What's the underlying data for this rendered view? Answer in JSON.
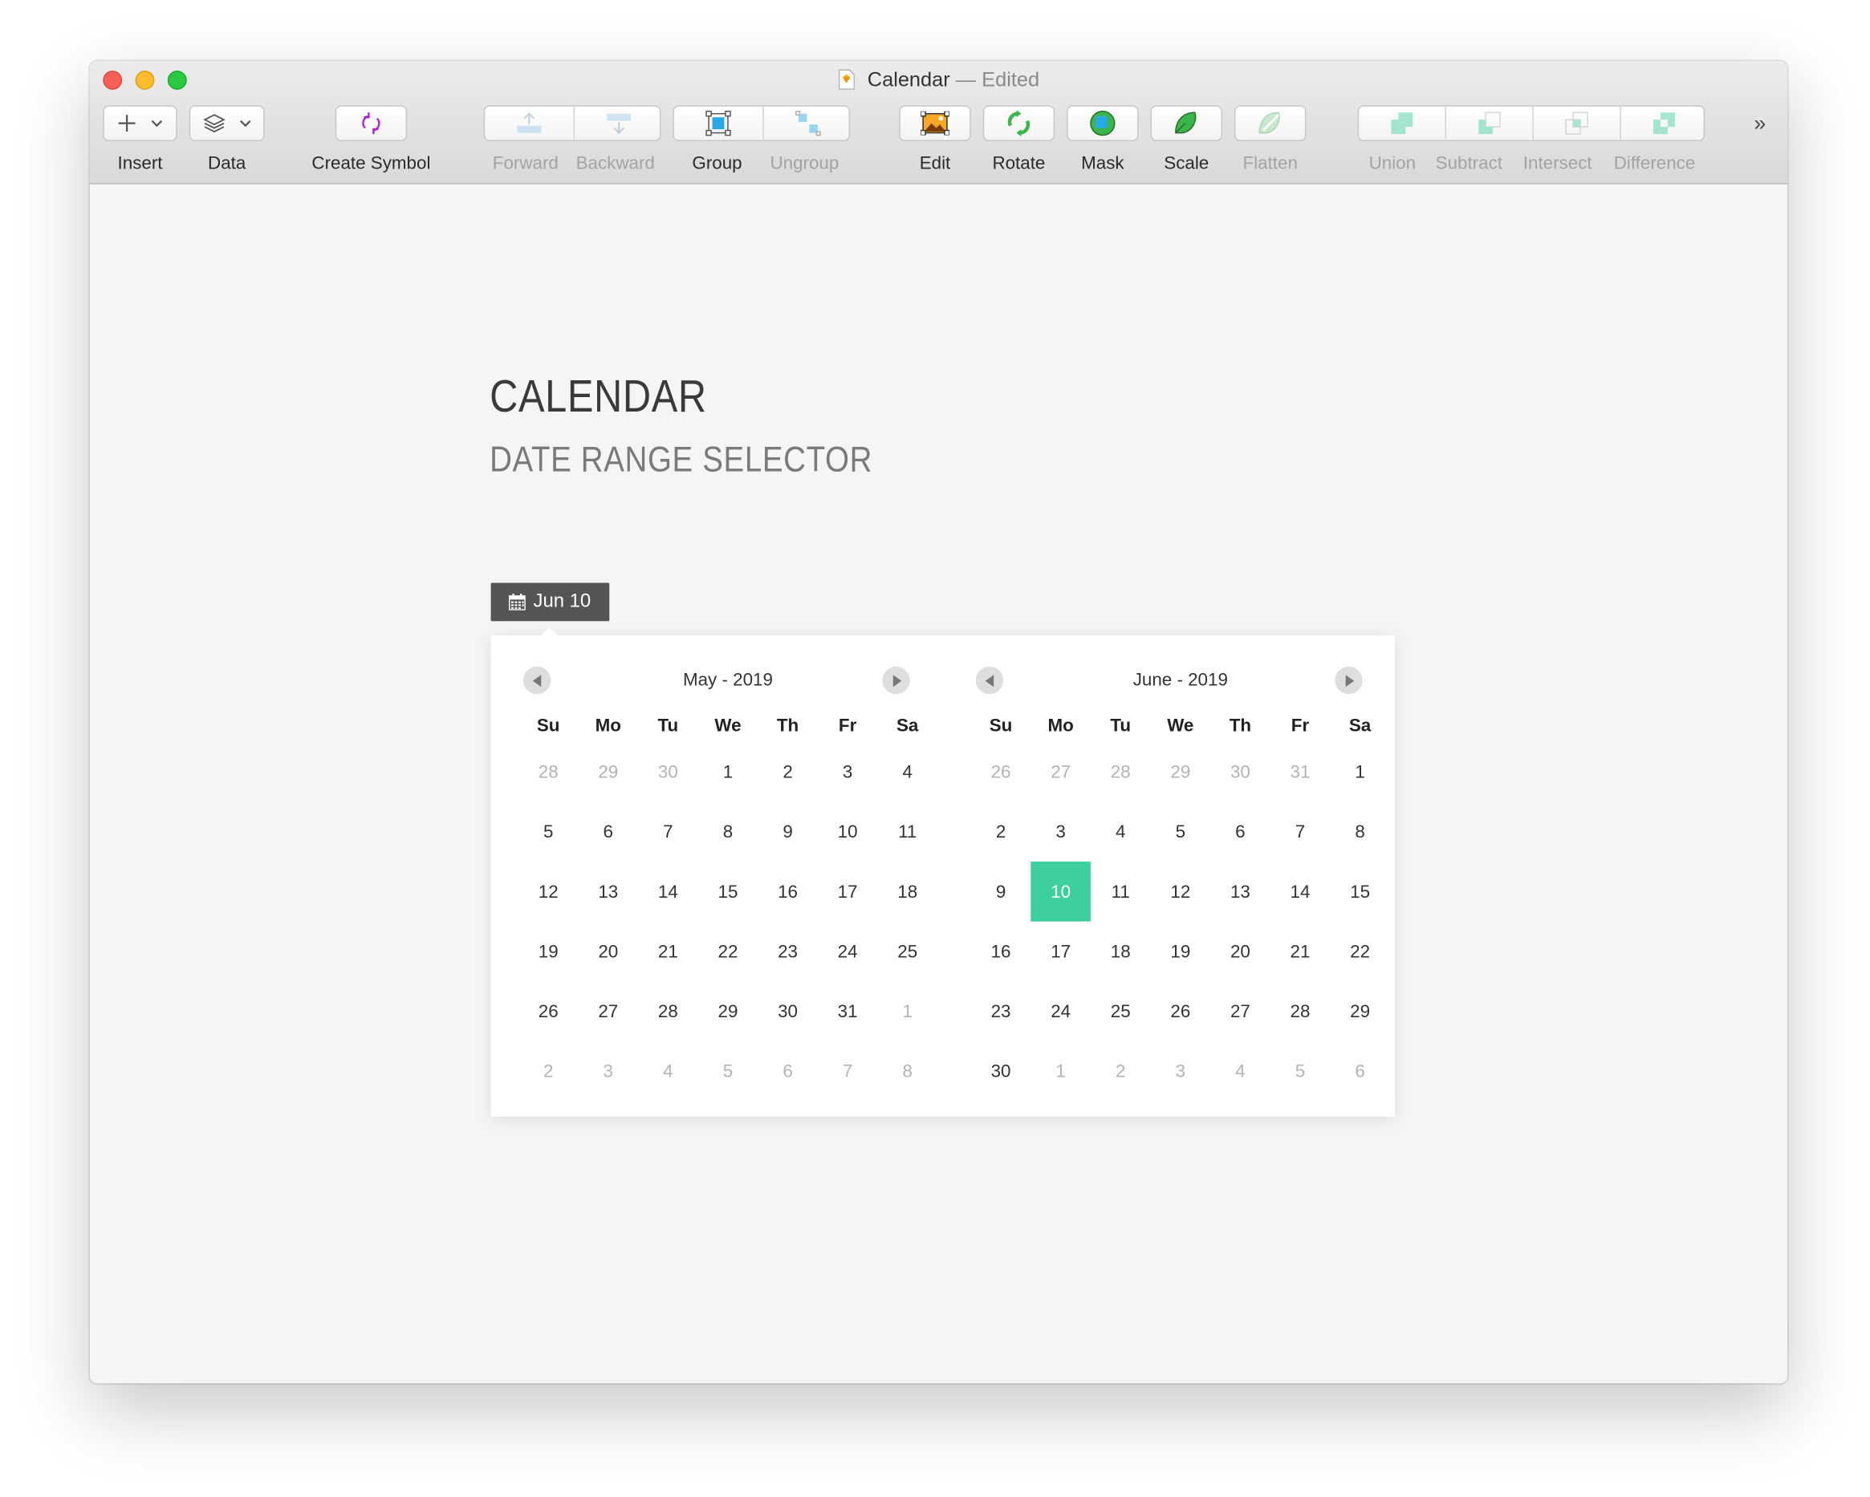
{
  "window": {
    "title": "Calendar",
    "title_suffix": "— Edited"
  },
  "toolbar": {
    "insert_label": "Insert",
    "data_label": "Data",
    "create_symbol_label": "Create Symbol",
    "forward_label": "Forward",
    "backward_label": "Backward",
    "group_label": "Group",
    "ungroup_label": "Ungroup",
    "edit_label": "Edit",
    "rotate_label": "Rotate",
    "mask_label": "Mask",
    "scale_label": "Scale",
    "flatten_label": "Flatten",
    "union_label": "Union",
    "subtract_label": "Subtract",
    "intersect_label": "Intersect",
    "difference_label": "Difference",
    "overflow_glyph": "»"
  },
  "page": {
    "heading": "CALENDAR",
    "subheading": "DATE RANGE SELECTOR",
    "date_pill": "Jun 10"
  },
  "weekdays": [
    "Su",
    "Mo",
    "Tu",
    "We",
    "Th",
    "Fr",
    "Sa"
  ],
  "months": [
    {
      "title": "May - 2019",
      "days": [
        "28",
        "29",
        "30",
        "1",
        "2",
        "3",
        "4",
        "5",
        "6",
        "7",
        "8",
        "9",
        "10",
        "11",
        "12",
        "13",
        "14",
        "15",
        "16",
        "17",
        "18",
        "19",
        "20",
        "21",
        "22",
        "23",
        "24",
        "25",
        "26",
        "27",
        "28",
        "29",
        "30",
        "31",
        "1",
        "2",
        "3",
        "4",
        "5",
        "6",
        "7",
        "8"
      ],
      "muted": [
        0,
        1,
        2,
        34,
        35,
        36,
        37,
        38,
        39,
        40,
        41
      ],
      "selected": []
    },
    {
      "title": "June - 2019",
      "days": [
        "26",
        "27",
        "28",
        "29",
        "30",
        "31",
        "1",
        "2",
        "3",
        "4",
        "5",
        "6",
        "7",
        "8",
        "9",
        "10",
        "11",
        "12",
        "13",
        "14",
        "15",
        "16",
        "17",
        "18",
        "19",
        "20",
        "21",
        "22",
        "23",
        "24",
        "25",
        "26",
        "27",
        "28",
        "29",
        "30",
        "1",
        "2",
        "3",
        "4",
        "5",
        "6"
      ],
      "muted": [
        0,
        1,
        2,
        3,
        4,
        5,
        36,
        37,
        38,
        39,
        40,
        41
      ],
      "selected": [
        15
      ]
    }
  ],
  "colors": {
    "selected_day": "#3ecf9e",
    "date_pill_bg": "#555555",
    "close": "#fc5f57",
    "minimize": "#fdbc2e",
    "maximize": "#28c840"
  }
}
